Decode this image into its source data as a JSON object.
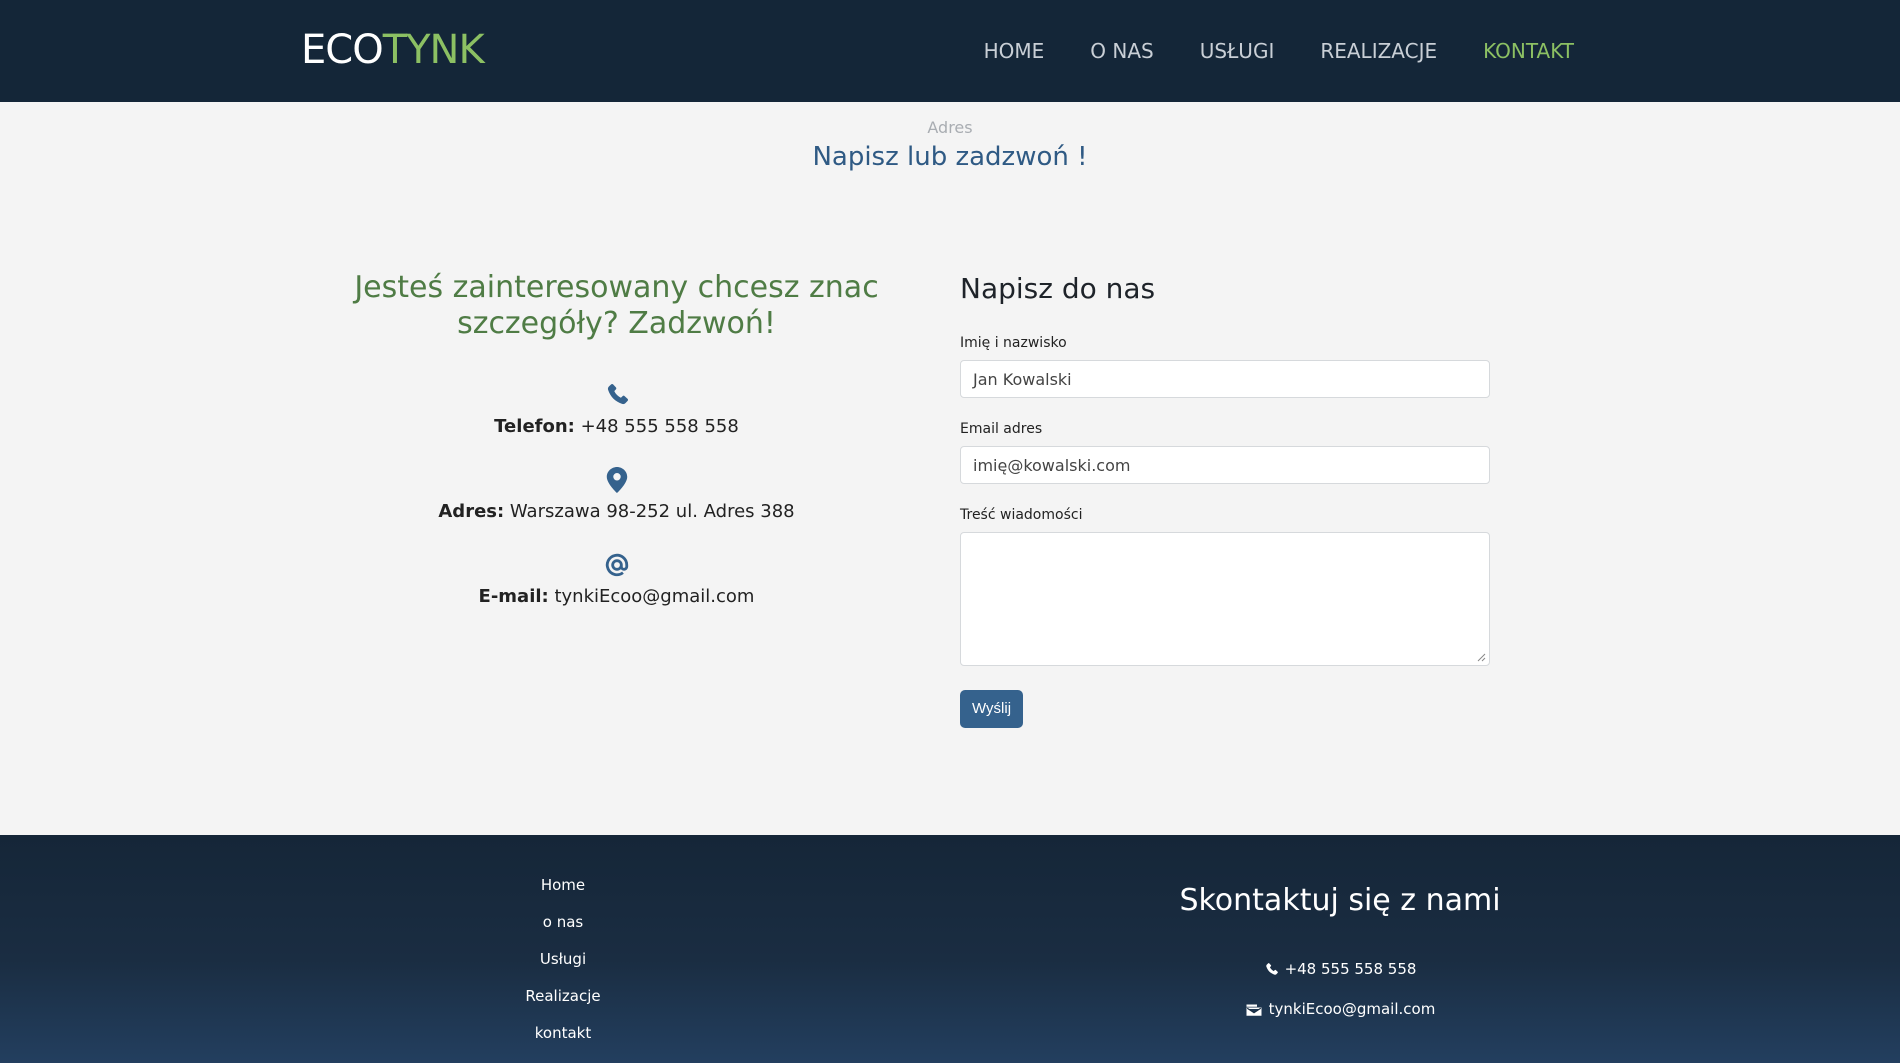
{
  "header": {
    "logo_part1": "ECO",
    "logo_part2": "TYNK",
    "nav": [
      "HOME",
      "O NAS",
      "USŁUGI",
      "REALIZACJE",
      "KONTAKT"
    ],
    "active_nav": "KONTAKT"
  },
  "hero": {
    "kicker": "Adres",
    "title": "Napisz lub zadzwoń !"
  },
  "contact": {
    "heading": "Jesteś zainteresowany chcesz znac szczegóły? Zadzwoń!",
    "phone_label": "Telefon:",
    "phone_value": " +48 555 558 558",
    "address_label": "Adres:",
    "address_value": " Warszawa 98-252 ul. Adres 388",
    "email_label": "E-mail:",
    "email_value": " tynkiEcoo@gmail.com",
    "icons": [
      "phone-icon",
      "location-pin-icon",
      "at-sign-icon"
    ]
  },
  "form": {
    "title": "Napisz do nas",
    "name_label": "Imię i nazwisko",
    "name_placeholder": "Jan Kowalski",
    "email_label": "Email adres",
    "email_placeholder": "imię@kowalski.com",
    "message_label": "Treść wiadomości",
    "message_value": "",
    "submit_label": "Wyślij"
  },
  "footer": {
    "links": [
      "Home",
      "o nas",
      "Usługi",
      "Realizacje",
      "kontakt"
    ],
    "contact_title": "Skontaktuj się z nami",
    "phone": "+48 555 558 558",
    "email": "tynkiEcoo@gmail.com"
  },
  "colors": {
    "header_bg": "#142638",
    "accent_green": "#8cc063",
    "heading_green": "#4f7c45",
    "brand_blue": "#35628d",
    "page_bg": "#f4f4f4"
  }
}
